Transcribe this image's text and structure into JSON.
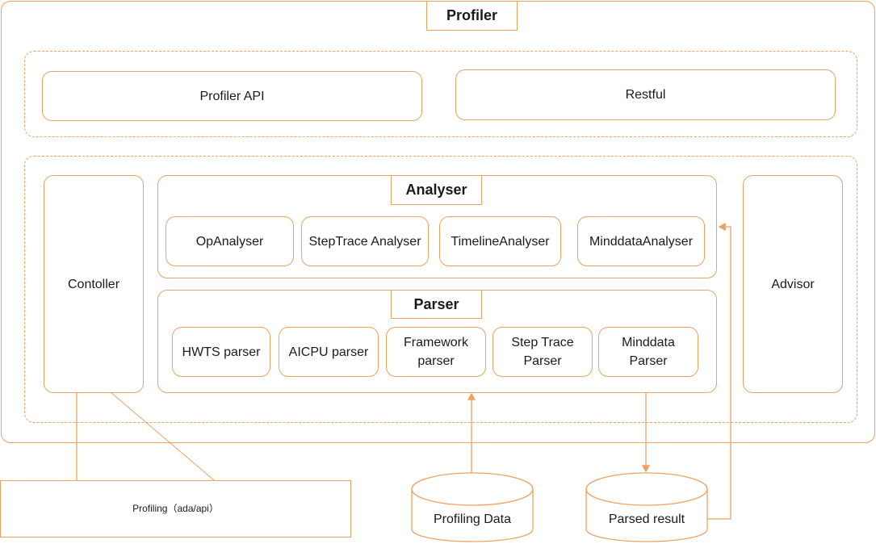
{
  "diagram": {
    "title": "Profiler",
    "interface_layer": {
      "items": [
        "Profiler API",
        "Restful"
      ]
    },
    "core_layer": {
      "controller": "Contoller",
      "advisor": "Advisor",
      "analyser": {
        "title": "Analyser",
        "items": [
          "OpAnalyser",
          "StepTrace Analyser",
          "TimelineAnalyser",
          "MinddataAnalyser"
        ]
      },
      "parser": {
        "title": "Parser",
        "items": [
          [
            "HWTS parser"
          ],
          [
            "AICPU parser"
          ],
          [
            "Framework",
            "parser"
          ],
          [
            "Step Trace",
            "Parser"
          ],
          [
            "Minddata",
            "Parser"
          ]
        ]
      }
    },
    "external": {
      "profiling_module": "Profiling（ada/api）",
      "profiling_data": "Profiling Data",
      "parsed_result": "Parsed result"
    },
    "colors": {
      "stroke": "#f0a060",
      "text": "#1a1a1a"
    }
  }
}
